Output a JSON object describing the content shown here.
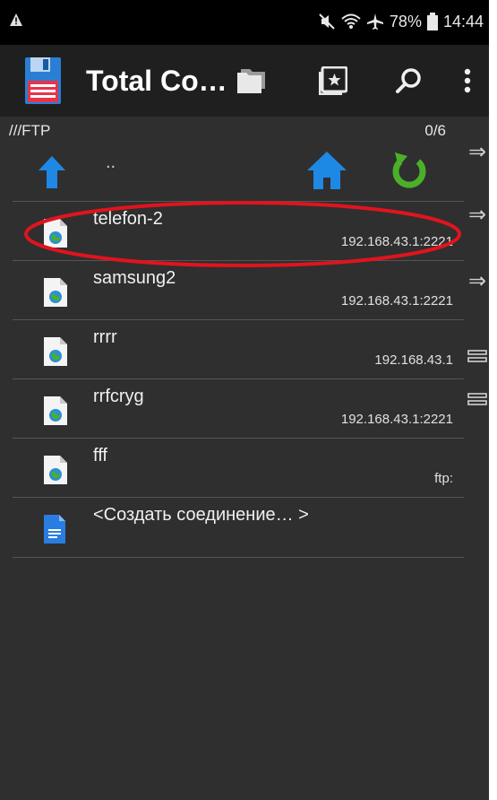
{
  "status_bar": {
    "battery": "78%",
    "time": "14:44",
    "icons": [
      "warning-icon",
      "mute-icon",
      "wifi-icon",
      "airplane-icon",
      "battery-icon"
    ]
  },
  "toolbar": {
    "title": "Total Co…",
    "buttons": [
      "folders-icon",
      "bookmarks-icon",
      "search-icon",
      "more-vert-icon"
    ]
  },
  "path_bar": {
    "path": "///FTP",
    "count": "0/6"
  },
  "up_row": {
    "label": ".."
  },
  "connections": [
    {
      "name": "telefon-2",
      "address": "192.168.43.1:2221"
    },
    {
      "name": "samsung2",
      "address": "192.168.43.1:2221"
    },
    {
      "name": "rrrr",
      "address": "192.168.43.1"
    },
    {
      "name": "rrfcryg",
      "address": "192.168.43.1:2221"
    },
    {
      "name": "fff",
      "address": "ftp:"
    }
  ],
  "create_connection": {
    "label": "<Создать соединение… >"
  },
  "side_panel": [
    "arrow-right-icon",
    "arrow-right-icon",
    "arrow-right-icon",
    "equals-icon",
    "equals-icon"
  ],
  "colors": {
    "background": "#2f2f2f",
    "toolbar": "#1f1f1f",
    "accent_blue": "#1e88e5",
    "refresh_green": "#4caf2a",
    "highlight_red": "#e0141e"
  }
}
